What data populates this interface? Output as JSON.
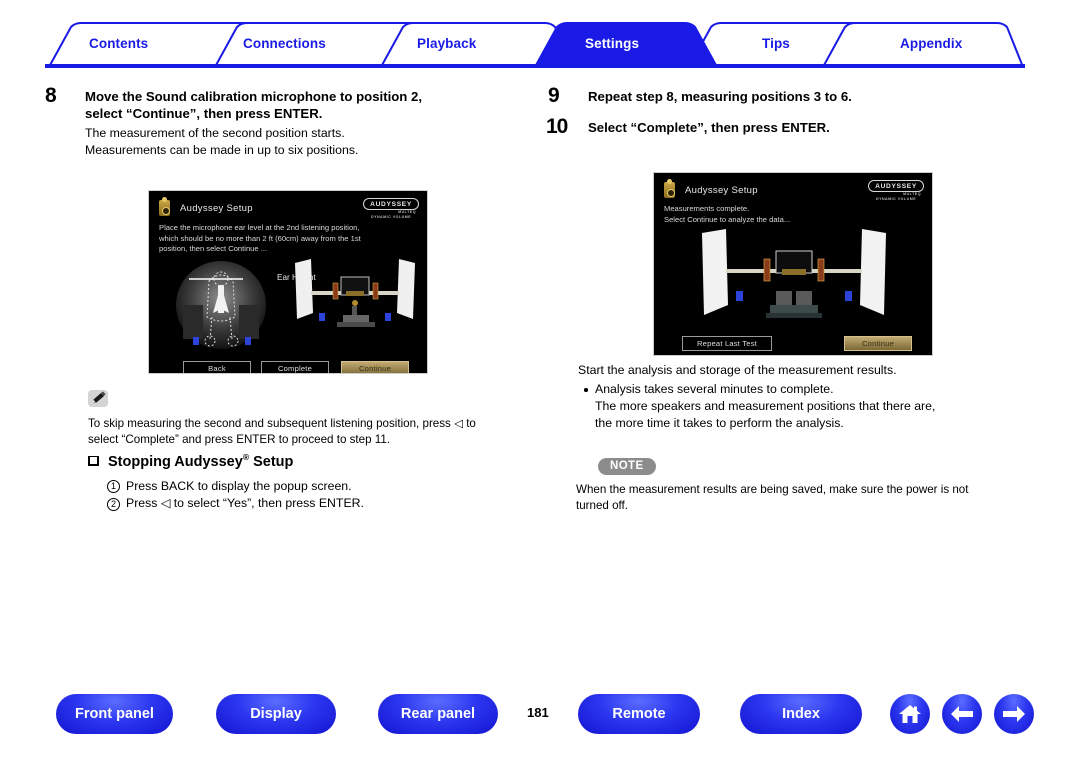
{
  "tabs": [
    {
      "label": "Contents",
      "active": false
    },
    {
      "label": "Connections",
      "active": false
    },
    {
      "label": "Playback",
      "active": false
    },
    {
      "label": "Settings",
      "active": true
    },
    {
      "label": "Tips",
      "active": false
    },
    {
      "label": "Appendix",
      "active": false
    }
  ],
  "colors": {
    "brand_blue": "#1a1ae6",
    "active_tab_fill": "#1a1ae6",
    "note_badge_gray": "#8c8c8c",
    "osd_highlight": "#b39a62"
  },
  "left_column": {
    "step8": {
      "number": "8",
      "title_line1": "Move the Sound calibration microphone to position 2,",
      "title_line2": "select “Continue”, then press ENTER.",
      "body_line1": "The measurement of the second position starts.",
      "body_line2": "Measurements can be made in up to six positions."
    },
    "osd1": {
      "title": "Audyssey Setup",
      "logo_main": "AUDYSSEY",
      "logo_sub1": "MULTEQ",
      "logo_sub2": "DYNAMIC VOLUME",
      "msg_line1": "Place the microphone ear level at the 2nd listening position,",
      "msg_line2": "which should be no more than 2 ft (60cm) away from the 1st",
      "msg_line3": "position, then select  Continue ...",
      "ear_height_label": "Ear Height",
      "buttons": [
        {
          "label": "Back",
          "highlighted": false
        },
        {
          "label": "Complete",
          "highlighted": false
        },
        {
          "label": "Continue",
          "highlighted": true
        }
      ]
    },
    "pencil_note": {
      "icon": "pencil-icon",
      "line1": "To skip measuring the second and subsequent listening position, press ◁ to",
      "line2": "select “Complete” and press ENTER to proceed to step 11."
    },
    "stopping_section": {
      "heading": "Stopping Audyssey",
      "heading_sup": "®",
      "heading_tail": " Setup",
      "items": [
        {
          "num": "1",
          "text": "Press BACK to display the popup screen."
        },
        {
          "num": "2",
          "text": "Press ◁ to select “Yes”, then press ENTER."
        }
      ]
    }
  },
  "right_column": {
    "step9": {
      "number": "9",
      "title": "Repeat step 8, measuring positions 3 to 6."
    },
    "step10": {
      "number": "10",
      "title": "Select “Complete”, then press ENTER."
    },
    "osd2": {
      "title": "Audyssey Setup",
      "logo_main": "AUDYSSEY",
      "logo_sub1": "MULTEQ",
      "logo_sub2": "DYNAMIC VOLUME",
      "msg_line1": "Measurements complete.",
      "msg_line2": "Select Continue to analyze the data...",
      "buttons": [
        {
          "label": "Repeat Last Test",
          "highlighted": false
        },
        {
          "label": "Continue",
          "highlighted": true
        }
      ]
    },
    "analysis_text": {
      "intro": "Start the analysis and storage of the measurement results.",
      "bullet_line1": "Analysis takes several minutes to complete.",
      "bullet_line2": "The more speakers and measurement positions that there are,",
      "bullet_line3": "the more time it takes to perform the analysis."
    },
    "note": {
      "badge": "NOTE",
      "line1": "When the measurement results are being saved, make sure the power is not",
      "line2": "turned off."
    }
  },
  "footer": {
    "buttons": [
      {
        "label": "Front panel"
      },
      {
        "label": "Display"
      },
      {
        "label": "Rear panel"
      },
      {
        "label": "Remote"
      },
      {
        "label": "Index"
      }
    ],
    "page_number": "181",
    "icons": [
      {
        "name": "home-icon"
      },
      {
        "name": "arrow-left-icon"
      },
      {
        "name": "arrow-right-icon"
      }
    ]
  }
}
